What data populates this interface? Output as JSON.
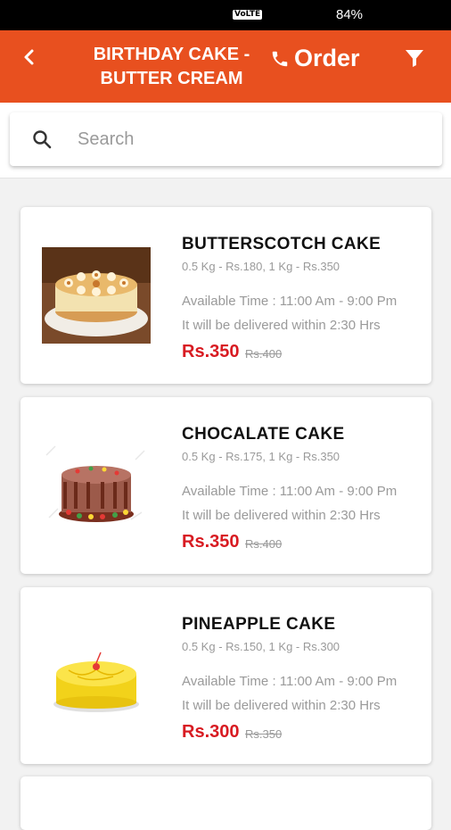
{
  "status_bar": {
    "network": "VoLTE",
    "battery": "84%"
  },
  "app_bar": {
    "back_icon": "back-chevron-icon",
    "title": "BIRTHDAY CAKE - BUTTER CREAM",
    "order_label": "Order",
    "order_icon": "phone-icon",
    "filter_icon": "filter-icon",
    "color": "#e8501f"
  },
  "search": {
    "placeholder": "Search",
    "value": "",
    "icon": "search-icon"
  },
  "products": [
    {
      "name": "BUTTERSCOTCH CAKE",
      "weights": "0.5 Kg - Rs.180, 1 Kg - Rs.350",
      "available": "Available Time : 11:00 Am - 9:00 Pm",
      "delivery": "It will be delivered within 2:30 Hrs",
      "price": "Rs.350",
      "old_price": "Rs.400",
      "image": "butterscotch-cake-image"
    },
    {
      "name": "CHOCALATE CAKE",
      "weights": "0.5 Kg - Rs.175, 1 Kg - Rs.350",
      "available": "Available Time : 11:00 Am - 9:00 Pm",
      "delivery": "It will be delivered within 2:30 Hrs",
      "price": "Rs.350",
      "old_price": "Rs.400",
      "image": "chocolate-cake-image"
    },
    {
      "name": "PINEAPPLE CAKE",
      "weights": "0.5 Kg - Rs.150, 1 Kg - Rs.300",
      "available": "Available Time : 11:00 Am - 9:00 Pm",
      "delivery": "It will be delivered within 2:30 Hrs",
      "price": "Rs.300",
      "old_price": "Rs.350",
      "image": "pineapple-cake-image"
    }
  ],
  "colors": {
    "price": "#d81b22",
    "muted": "#9a9a9a"
  }
}
